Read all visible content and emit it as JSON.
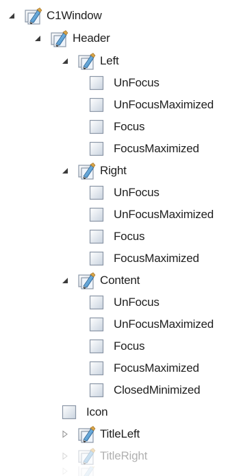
{
  "tree": {
    "root": {
      "label": "C1Window",
      "icon": "brush-style-icon",
      "expanded": true
    },
    "header": {
      "label": "Header",
      "icon": "brush-style-icon",
      "expanded": true
    },
    "left": {
      "label": "Left",
      "icon": "brush-style-icon",
      "expanded": true,
      "items": [
        "UnFocus",
        "UnFocusMaximized",
        "Focus",
        "FocusMaximized"
      ]
    },
    "right": {
      "label": "Right",
      "icon": "brush-style-icon",
      "expanded": true,
      "items": [
        "UnFocus",
        "UnFocusMaximized",
        "Focus",
        "FocusMaximized"
      ]
    },
    "content": {
      "label": "Content",
      "icon": "brush-style-icon",
      "expanded": true,
      "items": [
        "UnFocus",
        "UnFocusMaximized",
        "Focus",
        "FocusMaximized",
        "ClosedMinimized"
      ]
    },
    "icon_item": {
      "label": "Icon",
      "icon": "state-square-icon"
    },
    "title_left": {
      "label": "TitleLeft",
      "icon": "brush-style-icon",
      "expanded": false
    },
    "title_right": {
      "label": "TitleRight",
      "icon": "brush-style-icon",
      "expanded": false
    }
  }
}
